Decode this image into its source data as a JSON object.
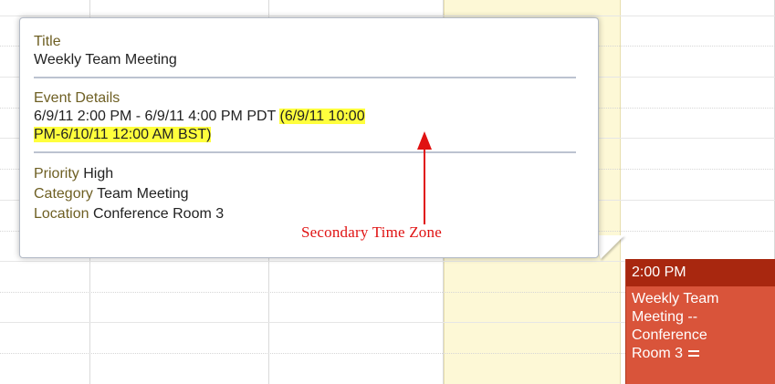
{
  "popup": {
    "title_label": "Title",
    "title_value": "Weekly Team Meeting",
    "details_label": "Event Details",
    "details_primary": "6/9/11 2:00 PM - 6/9/11 4:00 PM PDT ",
    "details_secondary_line1": "(6/9/11 10:00",
    "details_secondary_line2": "PM-6/10/11 12:00 AM BST)",
    "priority_label": "Priority",
    "priority_value": "High",
    "category_label": "Category",
    "category_value": "Team Meeting",
    "location_label": "Location",
    "location_value": "Conference Room 3"
  },
  "annotation": {
    "text": "Secondary Time Zone",
    "color": "#e01212"
  },
  "event": {
    "time": "2:00 PM",
    "line1": "Weekly Team",
    "line2": "Meeting --",
    "line3": "Conference",
    "line4": "Room 3",
    "header_color": "#a8270f",
    "body_color": "#d9543a"
  },
  "colors": {
    "highlight": "#ffff3d",
    "label": "#6e5f23",
    "today_column": "#fdf8d6"
  },
  "icons": {
    "resize_handle": "resize-grip-icon"
  }
}
